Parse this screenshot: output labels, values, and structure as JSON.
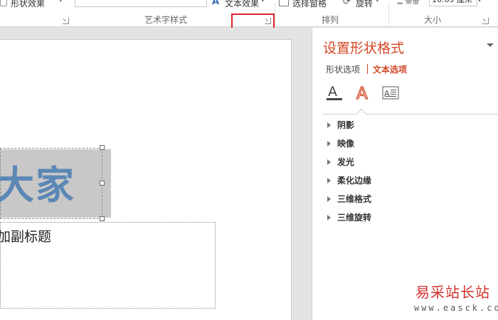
{
  "ribbon": {
    "shape_effects": "形状效果",
    "wordart_group": "艺术字样式",
    "text_effects": "文本效果",
    "selection_pane": "选择窗格",
    "rotate": "旋转",
    "arrange_group": "排列",
    "size_value": "16.69 厘米",
    "size_group": "大小"
  },
  "slide": {
    "title_text": "大家",
    "subtitle_text": "加副标题",
    "title_color": "#5b87b5"
  },
  "pane": {
    "title": "设置形状格式",
    "tab_shape": "形状选项",
    "tab_text": "文本选项",
    "accent_color": "#d24726",
    "icons": [
      "text-fill-outline-icon",
      "text-effects-icon",
      "text-box-icon"
    ],
    "sections": [
      "阴影",
      "映像",
      "发光",
      "柔化边缘",
      "三维格式",
      "三维旋转"
    ]
  },
  "watermark": {
    "title": "易采站长站",
    "url": "www.easck.com"
  }
}
